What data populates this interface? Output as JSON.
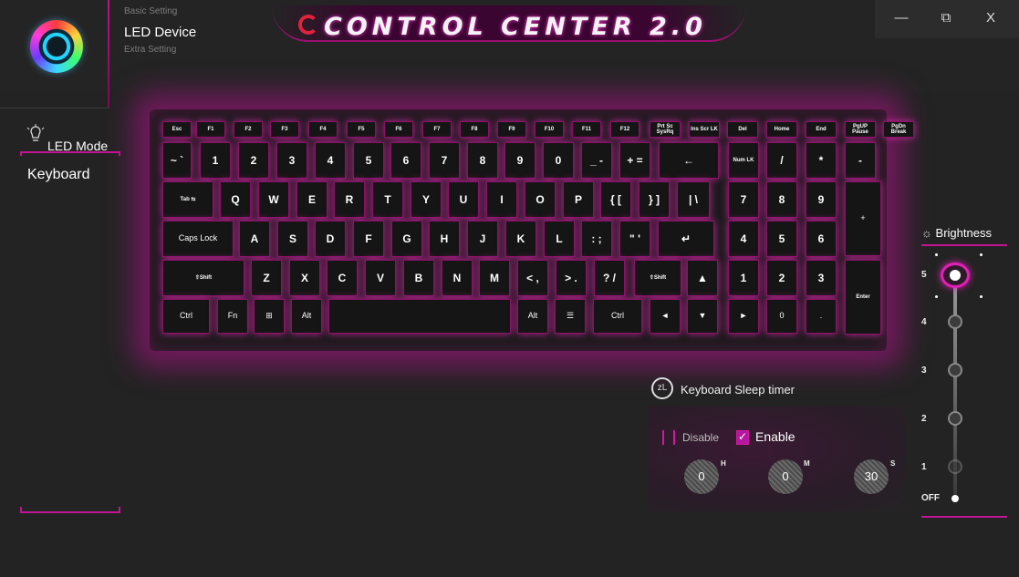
{
  "header": {
    "title": "CONTROL CENTER 2.0",
    "nav": {
      "basic": "Basic Setting",
      "current": "LED Device",
      "extra": "Extra Setting"
    },
    "window_controls": {
      "minimize": "—",
      "restore": "⧉",
      "close": "X"
    }
  },
  "sidebar": {
    "section_label": "LED Mode",
    "items": [
      {
        "label": "Keyboard"
      }
    ]
  },
  "keyboard": {
    "row_fn": [
      "Esc",
      "F1",
      "F2",
      "F3",
      "F4",
      "F5",
      "F6",
      "F7",
      "F8",
      "F9",
      "F10",
      "F11",
      "F12",
      "Prt Sc SysRq",
      "Ins Scr LK",
      "Del",
      "Home",
      "End",
      "PgUP Pause",
      "PgDn Break"
    ],
    "row_num": [
      "~ `",
      "1",
      "2",
      "3",
      "4",
      "5",
      "6",
      "7",
      "8",
      "9",
      "0",
      "_ -",
      "+ =",
      "←",
      "Num LK",
      "/",
      "*",
      "-"
    ],
    "row_tab": [
      "Tab ⇆",
      "Q",
      "W",
      "E",
      "R",
      "T",
      "Y",
      "U",
      "I",
      "O",
      "P",
      "{ [",
      "} ]",
      "| \\",
      "7",
      "8",
      "9",
      "+"
    ],
    "row_caps": [
      "Caps Lock",
      "A",
      "S",
      "D",
      "F",
      "G",
      "H",
      "J",
      "K",
      "L",
      ": ;",
      "\" '",
      "↵",
      "4",
      "5",
      "6"
    ],
    "row_shift": [
      "⇧Shift",
      "Z",
      "X",
      "C",
      "V",
      "B",
      "N",
      "M",
      "< ,",
      "> .",
      "? /",
      "⇧Shift",
      "▲",
      "1",
      "2",
      "3",
      "Enter"
    ],
    "row_ctrl": [
      "Ctrl",
      "Fn",
      "⊞",
      "Alt",
      "",
      "Alt",
      "☰",
      "Ctrl",
      "◄",
      "▼",
      "►",
      "0",
      "."
    ]
  },
  "sleep_timer": {
    "title": "Keyboard Sleep timer",
    "disable_label": "Disable",
    "enable_label": "Enable",
    "enabled": true,
    "hours": "0",
    "minutes": "0",
    "seconds": "30",
    "unit_h": "H",
    "unit_m": "M",
    "unit_s": "S"
  },
  "brightness": {
    "title": "Brightness",
    "levels": [
      "5",
      "4",
      "3",
      "2",
      "1",
      "OFF"
    ],
    "selected": "5"
  },
  "colors": {
    "accent": "#c21494",
    "glow": "#e21fb6",
    "background": "#232323"
  }
}
